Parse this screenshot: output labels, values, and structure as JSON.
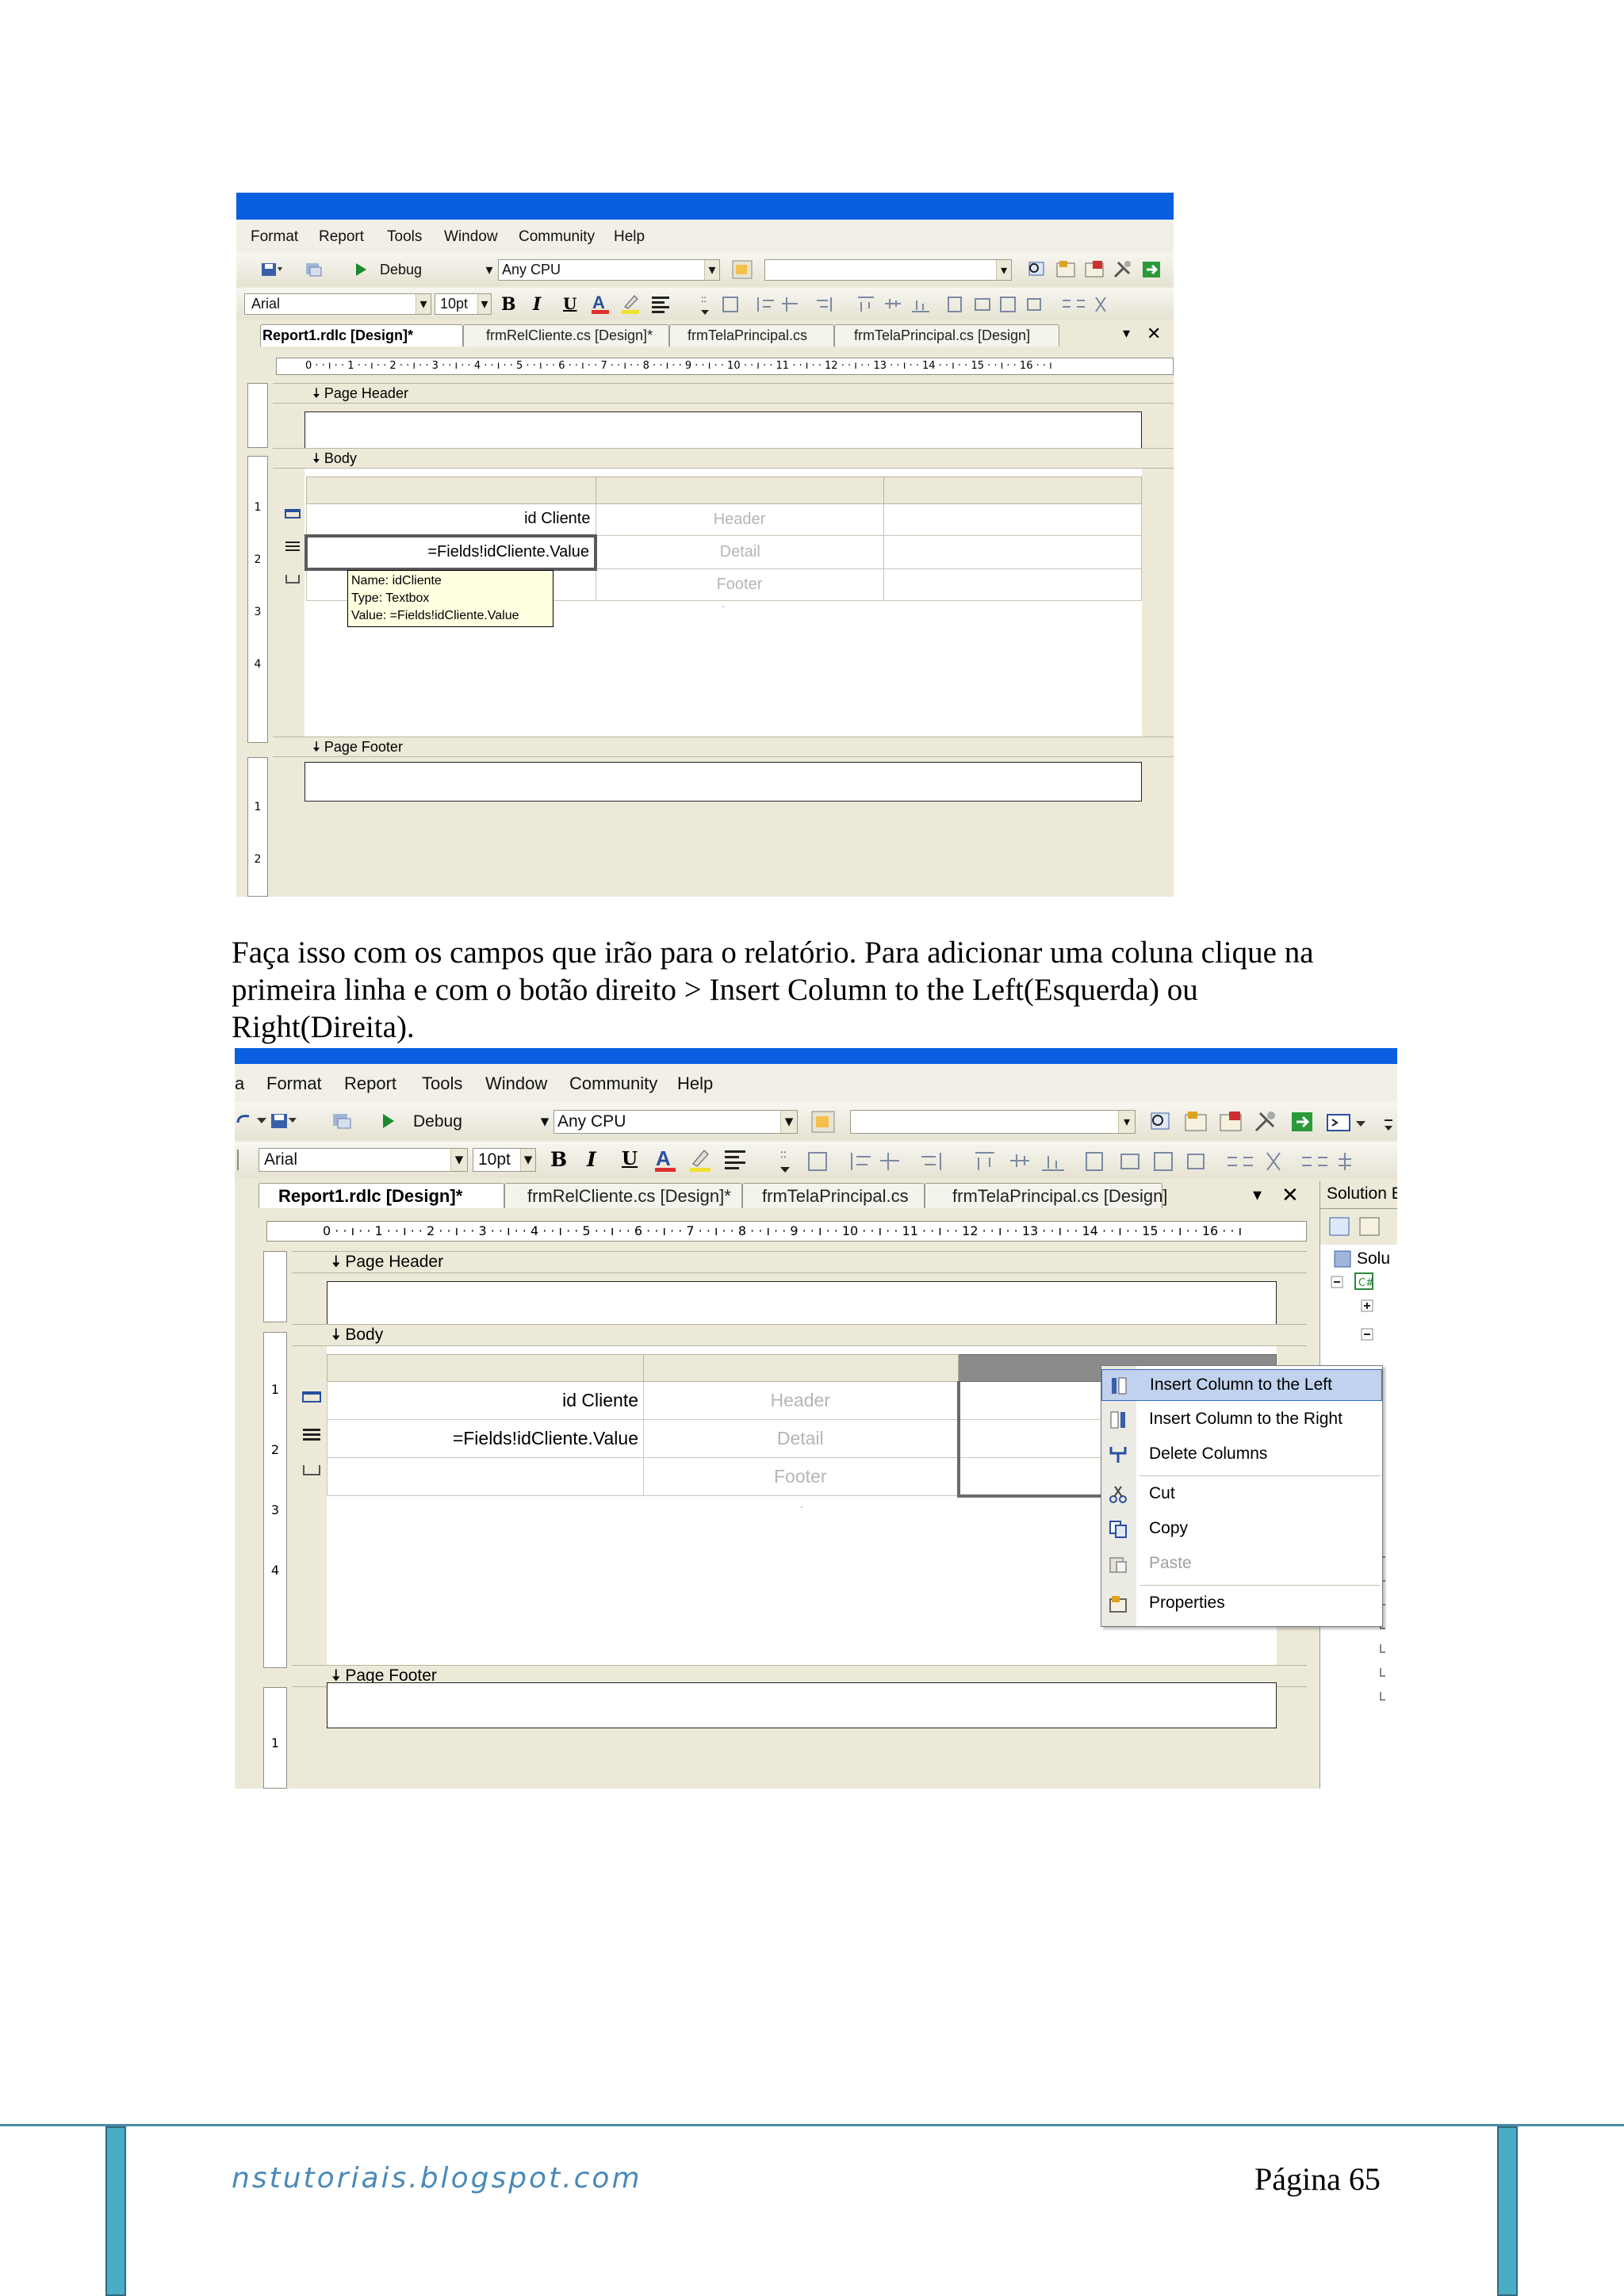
{
  "screenshot1": {
    "menu": [
      "Format",
      "Report",
      "Tools",
      "Window",
      "Community",
      "Help"
    ],
    "config": "Debug",
    "platform": "Any CPU",
    "font": "Arial",
    "size": "10pt",
    "tabs": [
      "Report1.rdlc [Design]*",
      "frmRelCliente.cs [Design]*",
      "frmTelaPrincipal.cs",
      "frmTelaPrincipal.cs [Design]"
    ],
    "ruler": "0 · · ı · · 1 · · ı · · 2 · · ı · · 3 · · ı · · 4 · · ı · · 5 · · ı · · 6 · · ı · · 7 · · ı · · 8 · · ı · · 9 · · ı · · 10 · · ı · · 11 · · ı · · 12 · · ı · · 13 · · ı · · 14 · · ı · · 15 · · ı · · 16 · · ı",
    "vruler_body": [
      "1",
      "2",
      "3",
      "4"
    ],
    "vruler_footer": [
      "1",
      "2"
    ],
    "sections": {
      "header": "Page Header",
      "body": "Body",
      "footer": "Page Footer"
    },
    "table": {
      "row1": [
        "id Cliente",
        "Header"
      ],
      "row2": [
        "=Fields!idCliente.Value",
        "Detail"
      ],
      "row3": [
        "",
        "Footer"
      ]
    },
    "tooltip": [
      "Name: idCliente",
      "Type: Textbox",
      "Value: =Fields!idCliente.Value"
    ]
  },
  "paragraph": [
    "Faça isso com os campos que irão para o relatório. Para adicionar uma coluna clique na",
    "primeira linha e com o botão direito > Insert Column to the Left(Esquerda) ou",
    "Right(Direita)."
  ],
  "screenshot2": {
    "menu_partial": "a",
    "menu": [
      "Format",
      "Report",
      "Tools",
      "Window",
      "Community",
      "Help"
    ],
    "config": "Debug",
    "platform": "Any CPU",
    "font": "Arial",
    "size": "10pt",
    "tabs": [
      "Report1.rdlc [Design]*",
      "frmRelCliente.cs [Design]*",
      "frmTelaPrincipal.cs",
      "frmTelaPrincipal.cs [Design]"
    ],
    "ruler": "0 · · ı · · 1 · · ı · · 2 · · ı · · 3 · · ı · · 4 · · ı · · 5 · · ı · · 6 · · ı · · 7 · · ı · · 8 · · ı · · 9 · · ı · · 10 · · ı · · 11 · · ı · · 12 · · ı · · 13 · · ı · · 14 · · ı · · 15 · · ı · · 16 · · ı",
    "vruler_body": [
      "1",
      "2",
      "3",
      "4"
    ],
    "vruler_footer": [
      "1"
    ],
    "sections": {
      "header": "Page Header",
      "body": "Body",
      "footer": "Page Footer"
    },
    "table": {
      "row1": [
        "id Cliente",
        "Header"
      ],
      "row2": [
        "=Fields!idCliente.Value",
        "Detail"
      ],
      "row3": [
        "",
        "Footer"
      ]
    },
    "solution_explorer": {
      "title": "Solution E",
      "node": "Solu"
    },
    "context_menu": {
      "insert_left": "Insert Column to the Left",
      "insert_right": "Insert Column to the Right",
      "delete": "Delete Columns",
      "cut": "Cut",
      "copy": "Copy",
      "paste": "Paste",
      "properties": "Properties"
    }
  },
  "footer": {
    "site": "nstutoriais.blogspot.com",
    "page": "Página 65"
  },
  "colors": {
    "titlebar": "#0a5fe0",
    "chrome": "#ece9d8",
    "footer_accent": "#4bacc6",
    "footer_text": "#4a8ab8",
    "menu_selection": "#c1d2ee"
  }
}
